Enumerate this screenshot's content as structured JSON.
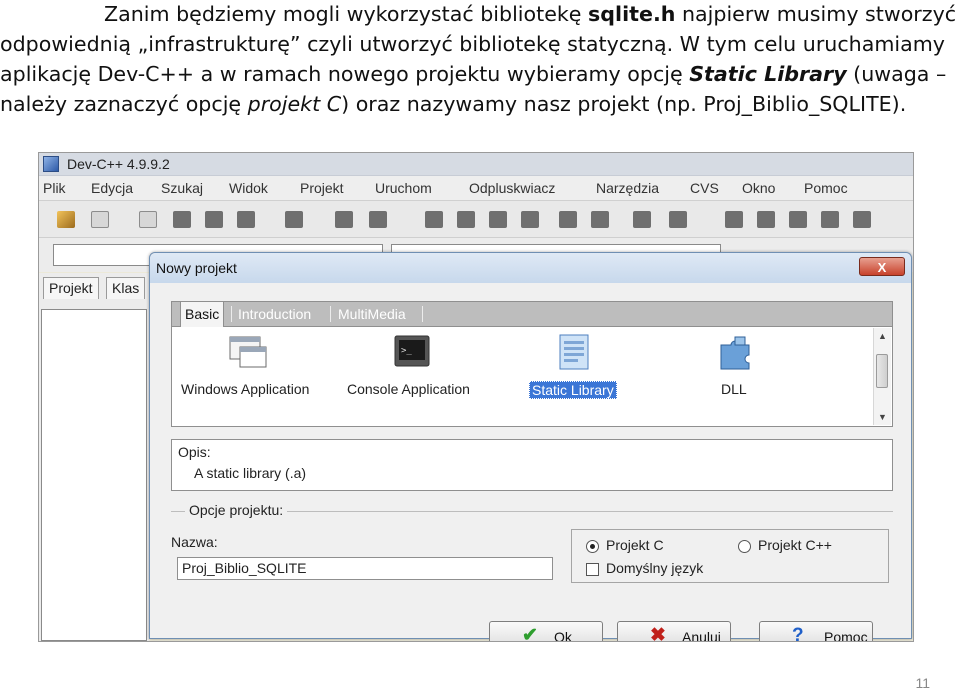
{
  "paragraph": {
    "line1": {
      "a": "Zanim będziemy mogli wykorzystać bibliotekę ",
      "bold": "sqlite.h",
      "b": " najpierw musimy stworzyć"
    },
    "line2": "odpowiednią „infrastrukturę” czyli utworzyć bibliotekę statyczną. W tym celu uruchamiamy",
    "line3": {
      "a": "aplikację Dev-C++ a w ramach nowego projektu wybieramy opcję ",
      "bold_italic": "Static Library",
      "b": " (uwaga –"
    },
    "line4": {
      "a": "należy zaznaczyć opcję ",
      "italic": "projekt C",
      "b": ") oraz nazywamy nasz projekt (np. Proj_Biblio_SQLITE)."
    }
  },
  "app": {
    "title": "Dev-C++ 4.9.9.2",
    "menu": [
      "Plik",
      "Edycja",
      "Szukaj",
      "Widok",
      "Projekt",
      "Uruchom",
      "Odpluskwiacz",
      "Narzędzia",
      "CVS",
      "Okno",
      "Pomoc"
    ],
    "left_tabs": [
      "Projekt",
      "Klas"
    ]
  },
  "dialog": {
    "title": "Nowy projekt",
    "close_label": "X",
    "tabs": [
      "Basic",
      "Introduction",
      "MultiMedia"
    ],
    "project_types": [
      {
        "label": "Windows Application",
        "icon": "window-icon",
        "selected": false
      },
      {
        "label": "Console Application",
        "icon": "console-icon",
        "selected": false
      },
      {
        "label": "Static Library",
        "icon": "library-icon",
        "selected": true
      },
      {
        "label": "DLL",
        "icon": "puzzle-icon",
        "selected": false
      }
    ],
    "opis_label": "Opis:",
    "opis_text": "A static library (.a)",
    "options_title": "Opcje projektu:",
    "name_label": "Nazwa:",
    "name_value": "Proj_Biblio_SQLITE",
    "radio_c": {
      "label": "Projekt C",
      "checked": true
    },
    "radio_cpp": {
      "label": "Projekt C++",
      "checked": false
    },
    "default_lang": {
      "label": "Domyślny język",
      "checked": false
    },
    "buttons": {
      "ok": "Ok",
      "cancel": "Anuluj",
      "help": "Pomoc"
    },
    "button_colors": {
      "ok": "#2e9e2e",
      "cancel": "#c0201a",
      "help": "#1f5fc9"
    }
  },
  "page_number": "11"
}
